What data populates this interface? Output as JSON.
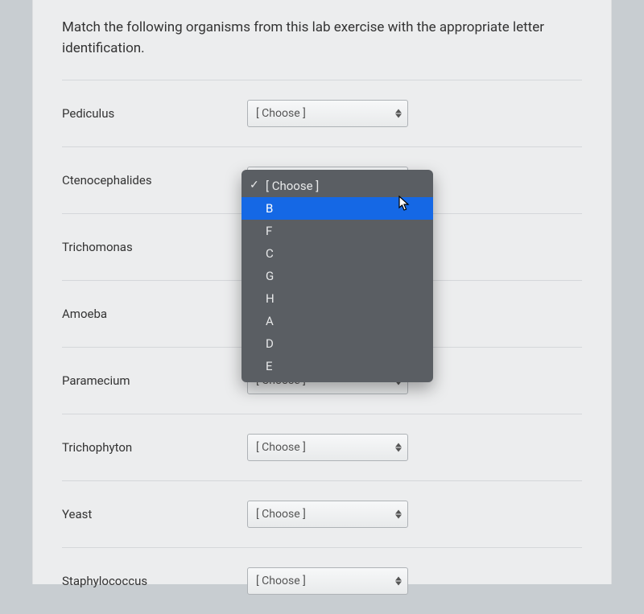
{
  "question": "Match the following organisms from this lab exercise with the appropriate letter identification.",
  "placeholder": "[ Choose ]",
  "items": [
    {
      "label": "Pediculus"
    },
    {
      "label": "Ctenocephalides"
    },
    {
      "label": "Trichomonas"
    },
    {
      "label": "Amoeba"
    },
    {
      "label": "Paramecium"
    },
    {
      "label": "Trichophyton"
    },
    {
      "label": "Yeast"
    },
    {
      "label": "Staphylococcus"
    }
  ],
  "dropdown": {
    "selected": "[ Choose ]",
    "highlighted": "B",
    "options": [
      "[ Choose ]",
      "B",
      "F",
      "C",
      "G",
      "H",
      "A",
      "D",
      "E"
    ]
  }
}
